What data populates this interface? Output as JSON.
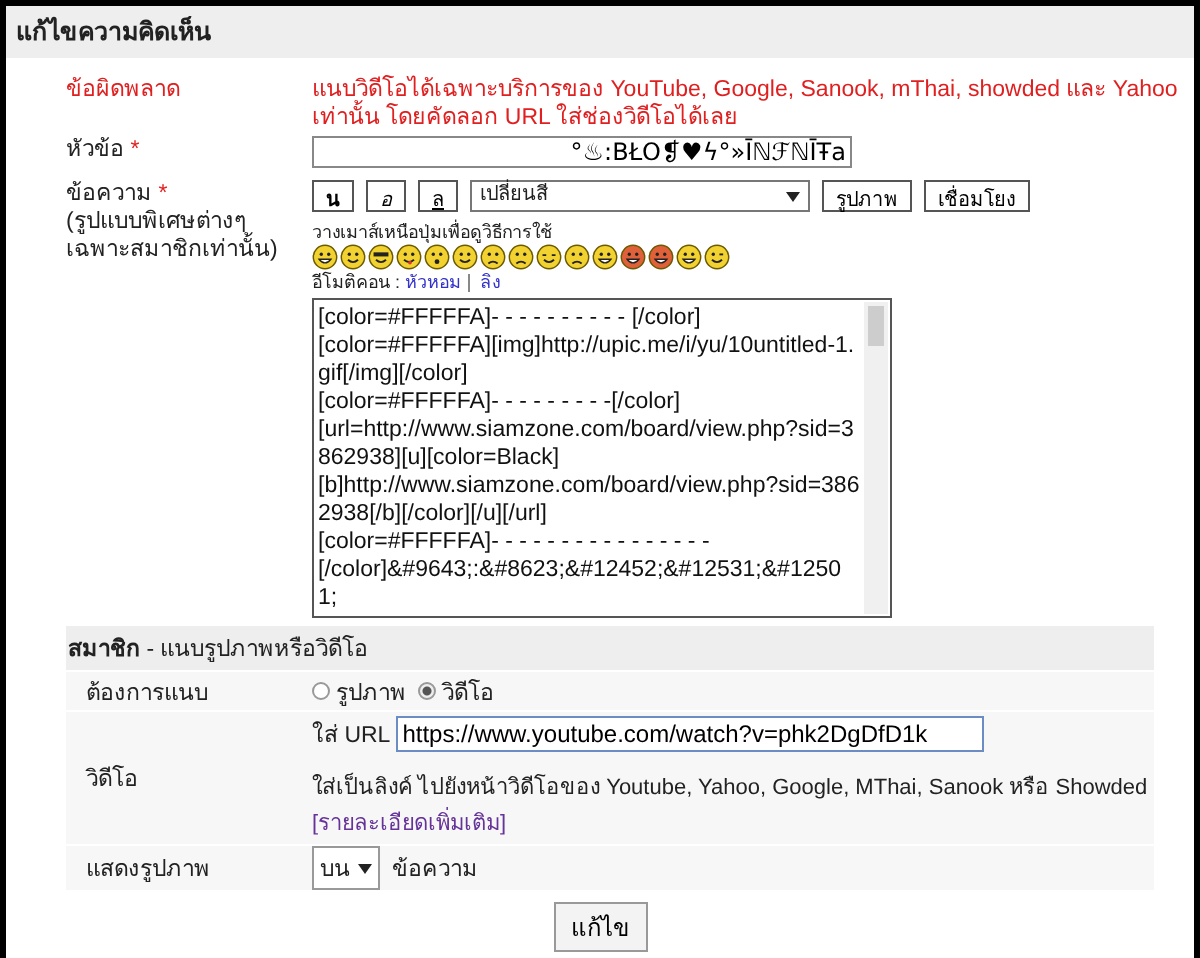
{
  "header": {
    "title": "แก้ไขความคิดเห็น"
  },
  "error": {
    "label": "ข้อผิดพลาด",
    "message": "แนบวิดีโอได้เฉพาะบริการของ YouTube, Google, Sanook, mThai, showded และ Yahoo เท่านั้น โดยคัดลอก URL ใส่ช่องวิดีโอได้เลย"
  },
  "subject": {
    "label": "หัวข้อ",
    "required_mark": "*",
    "value": "°♨:BŁO❡♥ϟ°»ĪℕℱℕĪŦa"
  },
  "message": {
    "label": "ข้อความ",
    "required_mark": "*",
    "note": "(รูปแบบพิเศษต่างๆ เฉพาะสมาชิกเท่านั้น)",
    "toolbar": [
      {
        "kind": "bold",
        "label": "น"
      },
      {
        "kind": "italic",
        "label": "อ"
      },
      {
        "kind": "underline",
        "label": "ล"
      },
      {
        "kind": "select",
        "label": "เปลี่ยนสี"
      },
      {
        "kind": "button",
        "label": "รูปภาพ"
      },
      {
        "kind": "button",
        "label": "เชื่อมโยง"
      }
    ],
    "hint": "วางเมาส์เหนือปุ่มเพื่อดูวิธีการใช้",
    "emoticons": [
      {
        "kind": "grin"
      },
      {
        "kind": "smile"
      },
      {
        "kind": "cool"
      },
      {
        "kind": "tongue"
      },
      {
        "kind": "shock"
      },
      {
        "kind": "smile"
      },
      {
        "kind": "sad"
      },
      {
        "kind": "sad"
      },
      {
        "kind": "sleepy"
      },
      {
        "kind": "angry"
      },
      {
        "kind": "grin"
      },
      {
        "kind": "devil"
      },
      {
        "kind": "devil"
      },
      {
        "kind": "grin"
      },
      {
        "kind": "wink"
      }
    ],
    "emoticon_sets_label": "อีโมติคอน :",
    "emoticon_sets": [
      "หัวหอม",
      "ลิง"
    ],
    "text": "[color=#FFFFFA]- - - - - - - - - - [/color]\n[color=#FFFFFA][img]http://upic.me/i/yu/10untitled-1.gif[/img][/color]\n[color=#FFFFFA]- - - - - - - - -[/color]\n[url=http://www.siamzone.com/board/view.php?sid=3862938][u][color=Black]\n[b]http://www.siamzone.com/board/view.php?sid=3862938[/b][/color][/u][/url]\n[color=#FFFFFA]- - - - - - - - - - - - - - - -\n[/color]&#9643;:&#8623;&#12452;&#12531;&#12501;"
  },
  "member": {
    "title": "สมาชิก",
    "subtitle": " - แนบรูปภาพหรือวิดีโอ",
    "attach": {
      "label": "ต้องการแนบ",
      "options": [
        {
          "label": "รูปภาพ",
          "selected": false
        },
        {
          "label": "วิดีโอ",
          "selected": true
        }
      ]
    },
    "video": {
      "label": "วิดีโอ",
      "url_label": "ใส่ URL",
      "url": "https://www.youtube.com/watch?v=phk2DgDfD1k",
      "help": "ใส่เป็นลิงค์ ไปยังหน้าวิดีโอของ Youtube, Yahoo, Google, MThai, Sanook หรือ Showded",
      "more_link": "[รายละเอียดเพิ่มเติม]"
    },
    "position": {
      "label": "แสดงรูปภาพ",
      "value": "บน",
      "suffix": "ข้อความ"
    }
  },
  "submit": "แก้ไข"
}
